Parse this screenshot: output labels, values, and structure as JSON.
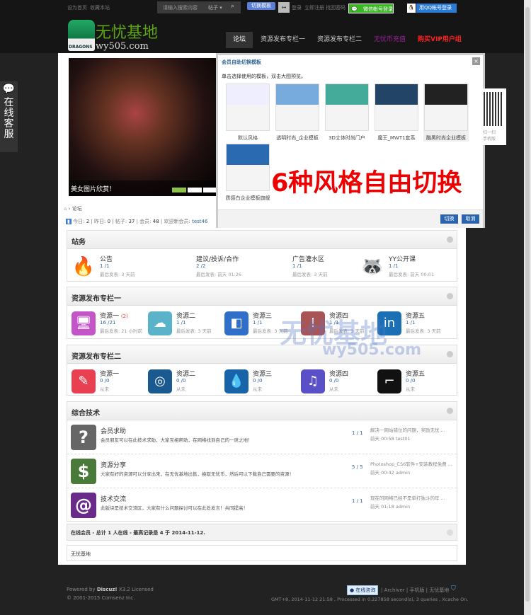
{
  "topbar": {
    "set_home": "设为首页",
    "bookmark": "收藏本站",
    "search_placeholder": "请输入搜索内容",
    "search_type": "帖子",
    "switch_template": "切换模板",
    "login": "登录",
    "register": "立即注册",
    "forgot": "找回密码",
    "wechat_login": "微信帐号登录",
    "qq_login": "用QQ帐号登录"
  },
  "logo": {
    "title": "无忧基地",
    "url": "wy505.com",
    "badge": "DRAGONS"
  },
  "nav": [
    "论坛",
    "资源发布专栏一",
    "资源发布专栏二",
    "无忧币充值",
    "购买VIP用户组"
  ],
  "nav_colors": [
    "#ffffff",
    "#cccccc",
    "#cccccc",
    "#a020a0",
    "#ff2020"
  ],
  "carousel": {
    "caption": "美女图片欣赏！"
  },
  "breadcrumb": {
    "current": "论坛"
  },
  "stats": {
    "today_label": "今日:",
    "today": "2",
    "yesterday_label": "昨日:",
    "yesterday": "0",
    "posts_label": "帖子:",
    "posts": "37",
    "members_label": "会员:",
    "members": "48",
    "welcome_label": "欢迎新会员:",
    "newest": "test46"
  },
  "sections": [
    {
      "title": "站务",
      "forums": [
        {
          "name": "公告",
          "counts": "1 /1",
          "last": "最后发表: 3 天前",
          "icon": "🔥",
          "color": "#e84"
        },
        {
          "name": "建议/投诉/合作",
          "counts": "2 /2",
          "last": "最后发表: 前天 01:26",
          "icon": "😵",
          "color": "#f90"
        },
        {
          "name": "广告灌水区",
          "counts": "1 /1",
          "last": "最后发表: 3 天前",
          "icon": "😠",
          "color": "#f80"
        },
        {
          "name": "YY公开课",
          "counts": "1 /1",
          "last": "最后发表: 前天 00:01",
          "icon": "🦝",
          "color": "#e9b030"
        }
      ]
    },
    {
      "title": "资源发布专栏一",
      "forums": [
        {
          "name": "资源一",
          "new": "(2)",
          "counts": "16 /21",
          "last": "最后发表: 21 小时前",
          "icon": "🖥",
          "color": "#c455c8"
        },
        {
          "name": "资源二",
          "counts": "1 /1",
          "last": "最后发表: 3 天前",
          "icon": "☁",
          "color": "#5bb3c9"
        },
        {
          "name": "资源三",
          "counts": "1 /1",
          "last": "最后发表: 3 天前",
          "icon": "◧",
          "color": "#2f6ec9"
        },
        {
          "name": "资源四",
          "counts": "1 /1",
          "last": "最后发表: 3 天前",
          "icon": "!",
          "color": "#a55"
        },
        {
          "name": "资源五",
          "counts": "1 /1",
          "last": "最后发表: 3 天前",
          "icon": "in",
          "color": "#1a6fb5"
        }
      ]
    },
    {
      "title": "资源发布专栏二",
      "forums": [
        {
          "name": "资源一",
          "counts": "0 /0",
          "last": "从未",
          "icon": "✎",
          "color": "#e84050"
        },
        {
          "name": "资源二",
          "counts": "0 /0",
          "last": "从未",
          "icon": "◎",
          "color": "#1a5a90"
        },
        {
          "name": "资源三",
          "counts": "0 /0",
          "last": "从未",
          "icon": "💧",
          "color": "#1765a8"
        },
        {
          "name": "资源四",
          "counts": "0 /0",
          "last": "从未",
          "icon": "♫",
          "color": "#5a50c8"
        },
        {
          "name": "资源五",
          "counts": "0 /0",
          "last": "从未",
          "icon": "⌐",
          "color": "#111"
        }
      ]
    },
    {
      "title": "综合技术",
      "rows": [
        {
          "name": "会员求助",
          "desc": "会员朋友可以在此技术求助，大家互相帮助，在网络找到自己的一席之地！",
          "counts": "1 / 1",
          "last_title": "解决一网站错位的问题，奖励无忧 ...",
          "last_meta": "前天 00:58 test01",
          "icon": "?",
          "color": "#666"
        },
        {
          "name": "资源分享",
          "desc": "大家有好的资源可以分享出来，在无忧基地出售，换取无忧币，然后可以下载自己需要的资源！",
          "counts": "5 / 5",
          "last_title": "Photoshop_CS6软件+安装教程免费 ...",
          "last_meta": "前天 00:42 admin",
          "icon": "$",
          "color": "#4a7a3a"
        },
        {
          "name": "技术交流",
          "desc": "此版块是技术交流区，大家有什么问题探讨可以在此处发言！共同提高！",
          "counts": "1 / 1",
          "last_title": "现在的网络已经不是单打独斗的年 ...",
          "last_meta": "前天 01:18 admin",
          "icon": "@",
          "color": "#6a2a8a"
        }
      ]
    }
  ],
  "online": "在线会员 - 总计 1 人在线 - 最高记录是 4 于 2014-11-12.",
  "friend_links": "无忧基地",
  "modal": {
    "title": "会员自助切换模板",
    "hint": "单击选择使用的模板，双击大图预览。",
    "templates": [
      "默认风格",
      "透明时尚_企业模板",
      "3D立体时尚门户",
      "魔王_MWT1套系",
      "酷黑时尚企业模板",
      "质感白企业模板旗舰"
    ],
    "promo": "6种风格自由切换",
    "ok": "切换",
    "cancel": "取消"
  },
  "sidebar": {
    "service": "在线客服",
    "qr_text": "扫一扫\n手机版"
  },
  "watermark": {
    "title": "无忧基地",
    "url": "wy505.com"
  },
  "footer": {
    "powered": "Powered by",
    "brand": "Discuz!",
    "version": "X3.2 Licensed",
    "copyright": "© 2001-2015 Comsenz Inc.",
    "consult": "在线咨询",
    "links": "| Archiver | 手机版 | 无忧基地",
    "stats": "GMT+8, 2014-11-12 21:58 , Processed in 0.227858 second(s), 3 queries , Xcache On."
  }
}
